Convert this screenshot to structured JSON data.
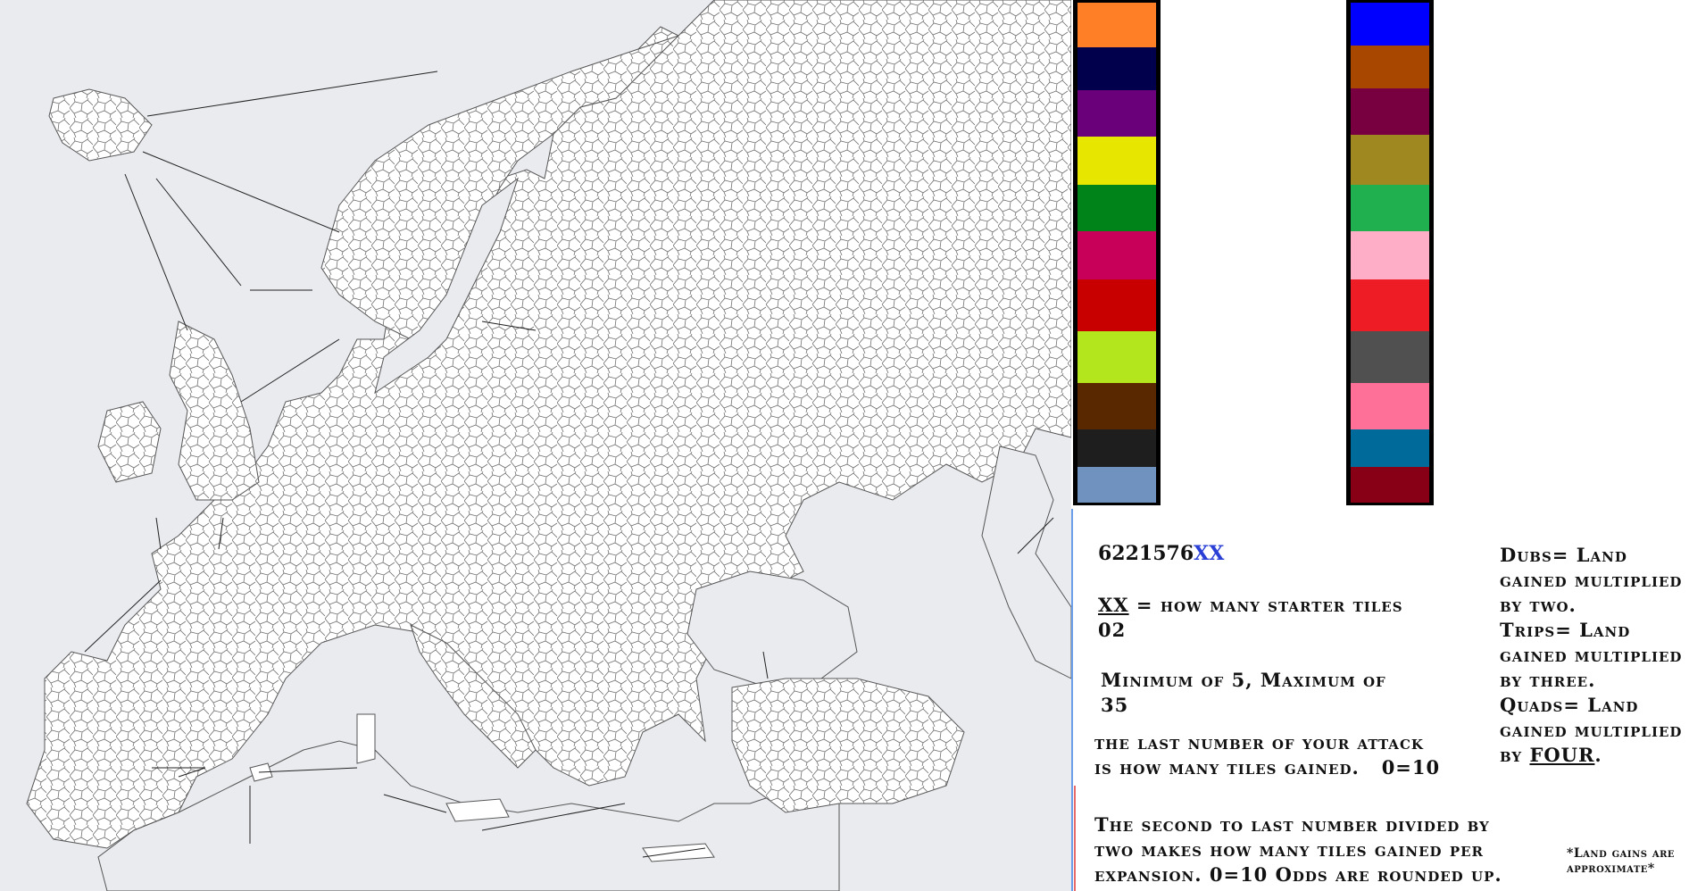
{
  "palette_left": {
    "colors": [
      "#ff7f27",
      "#00004c",
      "#6a007a",
      "#e6e600",
      "#00841a",
      "#c8005a",
      "#c80000",
      "#b4e61e",
      "#5a2800",
      "#1e1e1e",
      "#7092be"
    ]
  },
  "palette_right": {
    "colors": [
      "#0000ff",
      "#a84800",
      "#780040",
      "#a08820",
      "#20b050",
      "#ffaec8",
      "#ee1c24",
      "#505050",
      "#ff7098",
      "#006a9a",
      "#880015"
    ]
  },
  "rules": {
    "code_prefix": "6221576",
    "code_suffix": "XX",
    "starter_tiles_key": "XX",
    "starter_tiles_text": "= how many starter tiles",
    "starter_tiles_value": "02",
    "min_max_line1": "Minimum of 5, Maximum of",
    "min_max_line2": "35",
    "last_number_line1": "the last number of your attack",
    "last_number_line2": "is how many tiles gained.   0=10",
    "second_last_line1": "The second to last number divided by",
    "second_last_line2": "two makes how many tiles gained per",
    "second_last_line3": "expansion. 0=10 Odds are rounded up."
  },
  "multipliers": {
    "dubs_line1": "Dubs= Land",
    "dubs_line2": "gained multiplied",
    "dubs_line3": "by two.",
    "trips_line1": "Trips= Land",
    "trips_line2": "gained multiplied",
    "trips_line3": "by three.",
    "quads_line1": "Quads= Land",
    "quads_line2": "gained multiplied",
    "quads_line3_prefix": "by",
    "quads_line3_emph": "FOUR",
    "quads_line3_suffix": "."
  },
  "footnote": {
    "line1": "*Land gains are",
    "line2": "approximate*"
  }
}
